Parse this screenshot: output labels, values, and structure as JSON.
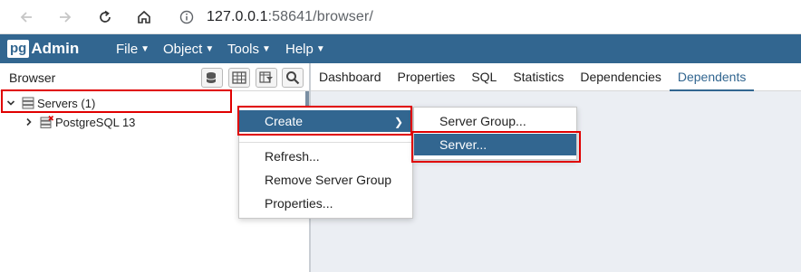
{
  "address_bar": {
    "url_host": "127.0.0.1",
    "url_rest": ":58641/browser/"
  },
  "navbar": {
    "logo_pg": "pg",
    "logo_admin": "Admin",
    "menus": [
      "File",
      "Object",
      "Tools",
      "Help"
    ]
  },
  "browser_panel": {
    "title": "Browser",
    "tree": {
      "group_label": "Servers (1)",
      "server_label": "PostgreSQL 13"
    }
  },
  "tabs": [
    "Dashboard",
    "Properties",
    "SQL",
    "Statistics",
    "Dependencies",
    "Dependents"
  ],
  "active_tab": "Dependents",
  "context_menu": {
    "items": [
      "Create",
      "Refresh...",
      "Remove Server Group",
      "Properties..."
    ]
  },
  "submenu": {
    "items": [
      "Server Group...",
      "Server..."
    ]
  },
  "colors": {
    "brand": "#326690",
    "highlight": "#e00000",
    "content_bg": "#ebeef3"
  }
}
